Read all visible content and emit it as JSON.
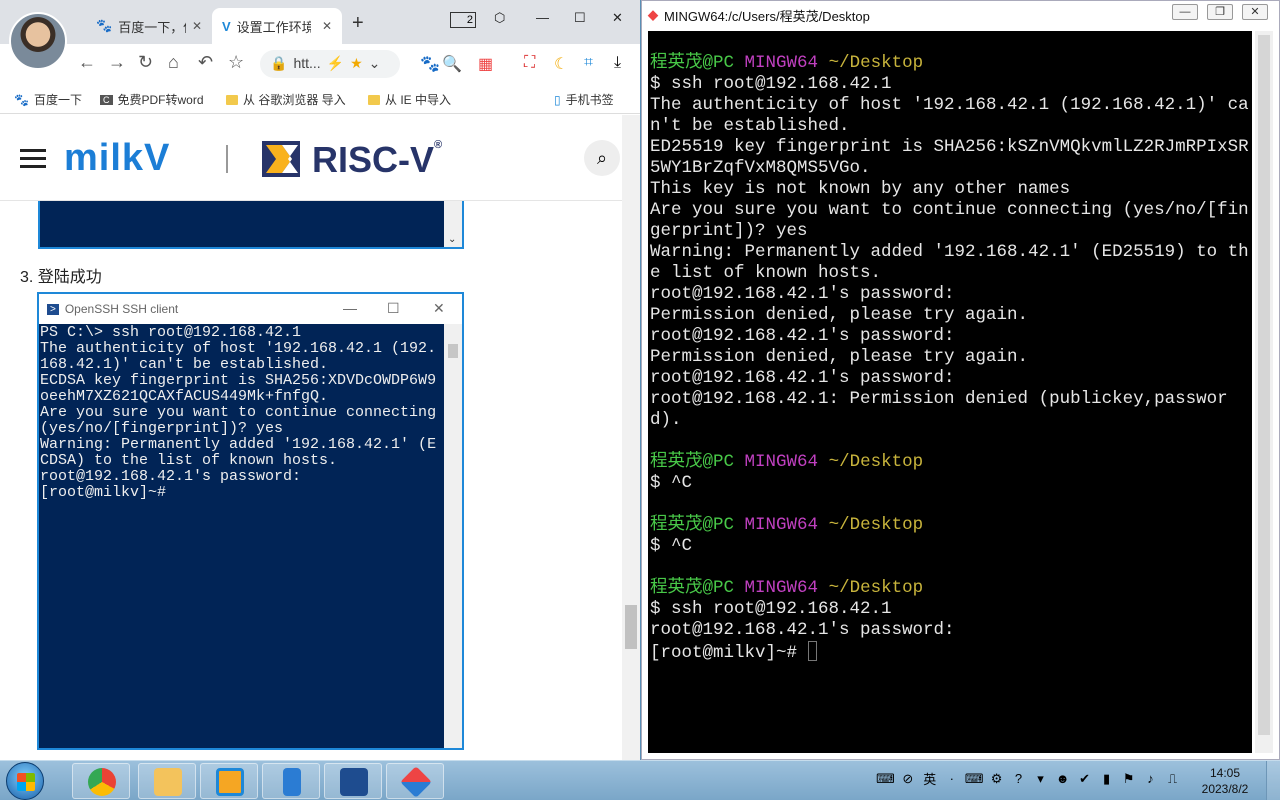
{
  "browser": {
    "tabs": [
      {
        "label": "百度一下，你就知道",
        "icon": "baidu-paw-icon"
      },
      {
        "label": "设置工作环境",
        "icon": "vmware-doc-icon"
      }
    ],
    "tab_count": "2",
    "url": "htt...",
    "bookmarks": [
      "百度一下",
      "免费PDF转word",
      "从 谷歌浏览器 导入",
      "从 IE 中导入",
      "手机书签"
    ],
    "site": {
      "brand": "milkV",
      "partner": "RISC-V",
      "registered": "®",
      "step_label": "3. 登陆成功"
    },
    "powershell": {
      "title": "OpenSSH SSH client",
      "output": "PS C:\\> ssh root@192.168.42.1\nThe authenticity of host '192.168.42.1 (192.168.42.1)' can't be established.\nECDSA key fingerprint is SHA256:XDVDcOWDP6W9oeehM7XZ621QCAXfACUS449Mk+fnfgQ.\nAre you sure you want to continue connecting (yes/no/[fingerprint])? yes\nWarning: Permanently added '192.168.42.1' (ECDSA) to the list of known hosts.\nroot@192.168.42.1's password:\n[root@milkv]~#"
    }
  },
  "terminal": {
    "title": "MINGW64:/c/Users/程英茂/Desktop",
    "prompt_user": "程英茂@PC",
    "prompt_env": "MINGW64",
    "prompt_path": "~/Desktop",
    "block1": "$ ssh root@192.168.42.1\nThe authenticity of host '192.168.42.1 (192.168.42.1)' can't be established.\nED25519 key fingerprint is SHA256:kSZnVMQkvmlLZ2RJmRPIxSR5WY1BrZqfVxM8QMS5VGo.\nThis key is not known by any other names\nAre you sure you want to continue connecting (yes/no/[fingerprint])? yes\nWarning: Permanently added '192.168.42.1' (ED25519) to the list of known hosts.\nroot@192.168.42.1's password:\nPermission denied, please try again.\nroot@192.168.42.1's password:\nPermission denied, please try again.\nroot@192.168.42.1's password:\nroot@192.168.42.1: Permission denied (publickey,password).\n",
    "block2": "$ ^C\n",
    "block3": "$ ^C\n",
    "block4": "$ ssh root@192.168.42.1\nroot@192.168.42.1's password:\n[root@milkv]~# "
  },
  "taskbar": {
    "apps": [
      "chrome-icon",
      "file-explorer-icon",
      "vmware-icon",
      "phone-link-icon",
      "powershell-icon",
      "git-icon"
    ],
    "ime_label": "英",
    "clock_time": "14:05",
    "clock_date": "2023/8/2"
  }
}
